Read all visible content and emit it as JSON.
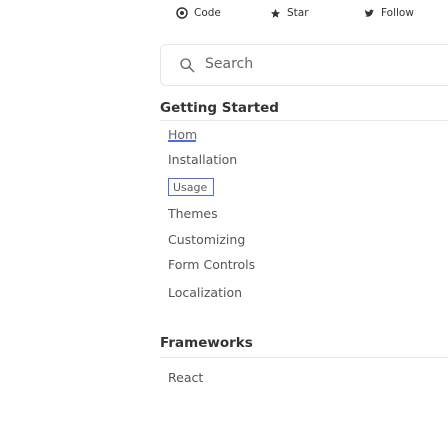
{
  "topbar": {
    "code_label": "Code",
    "star_label": "Star",
    "follow_label": "Follow"
  },
  "search": {
    "placeholder": "Search"
  },
  "sections": {
    "getting_started": {
      "title": "Getting Started",
      "items": {
        "home": "Home",
        "installation": "Installation",
        "usage": "Usage",
        "themes": "Themes",
        "customizing": "Customizing",
        "form_controls": "Form Controls",
        "localization": "Localization"
      }
    },
    "frameworks": {
      "title": "Frameworks",
      "items": {
        "react": "React"
      }
    }
  },
  "colors": {
    "accent": "#4f6bed",
    "text": "#555555",
    "border": "#e6e6e6"
  }
}
